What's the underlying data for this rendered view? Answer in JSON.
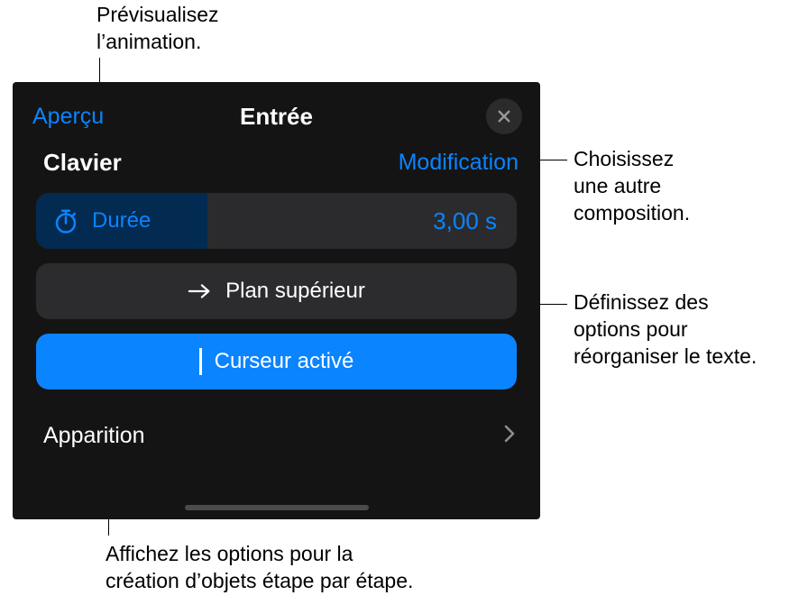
{
  "callouts": {
    "top": "Prévisualisez\nl’animation.",
    "right1": "Choisissez\nune autre\ncomposition.",
    "right2": "Définissez des\noptions pour\nréorganiser le texte.",
    "bottom": "Affichez les options pour la\ncréation d’objets étape par étape."
  },
  "panel": {
    "preview": "Aperçu",
    "title": "Entrée",
    "subLabel": "Clavier",
    "subAction": "Modification",
    "duration": {
      "label": "Durée",
      "value": "3,00 s"
    },
    "topLevel": "Plan supérieur",
    "cursor": "Curseur activé",
    "appearance": "Apparition"
  }
}
